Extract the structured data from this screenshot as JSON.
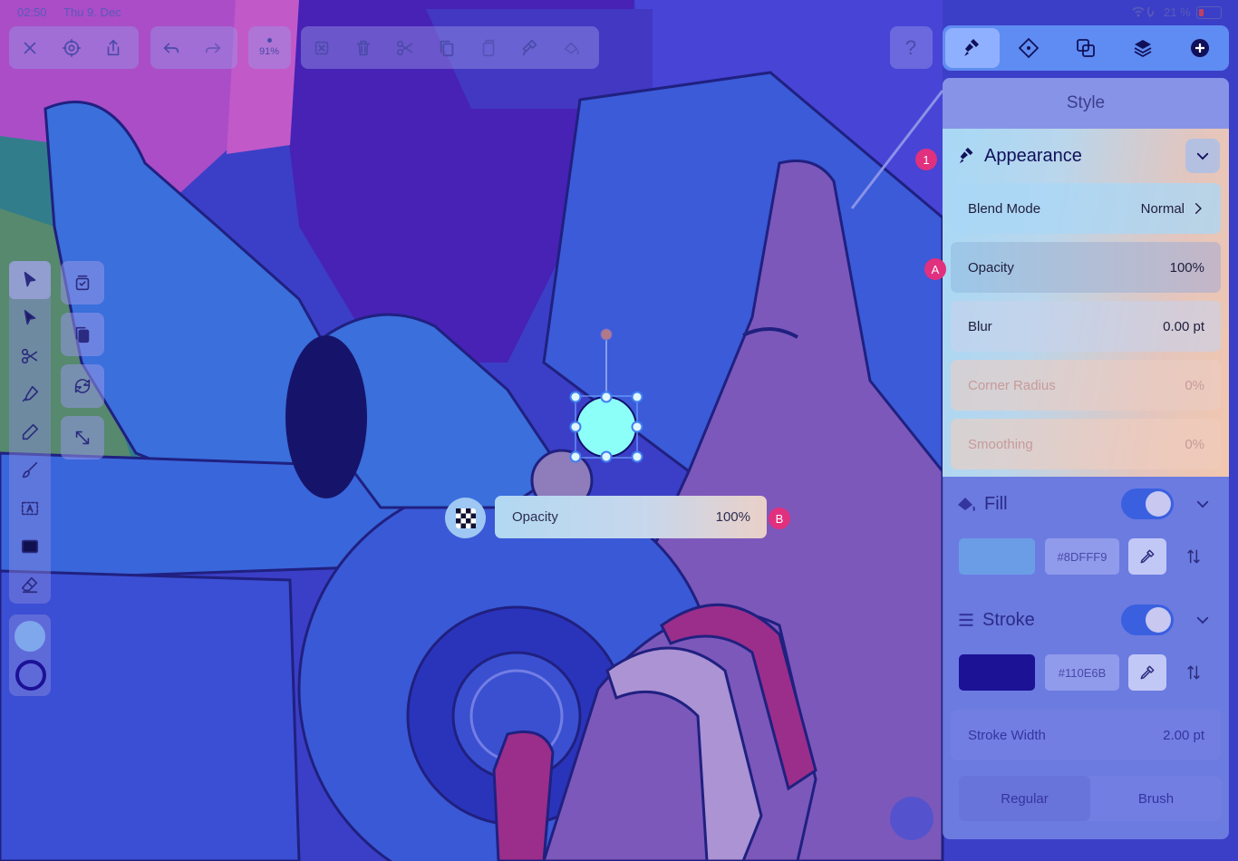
{
  "status_bar": {
    "time": "02:50",
    "date": "Thu 9. Dec",
    "battery": "21 %"
  },
  "toolbar": {
    "zoom": "91%",
    "help": "?"
  },
  "colors": {
    "accent": "#3a60e0",
    "badge": "#e0307e",
    "fill_swatch": "#8DFFF9",
    "stroke_swatch": "#110E6B"
  },
  "panel": {
    "title": "Style",
    "appearance": {
      "label": "Appearance",
      "badge": "1",
      "blend_mode": {
        "label": "Blend Mode",
        "value": "Normal"
      },
      "opacity": {
        "label": "Opacity",
        "value": "100%",
        "badge": "A"
      },
      "blur": {
        "label": "Blur",
        "value": "0.00 pt"
      },
      "corner_radius": {
        "label": "Corner Radius",
        "value": "0%"
      },
      "smoothing": {
        "label": "Smoothing",
        "value": "0%"
      }
    },
    "fill": {
      "label": "Fill",
      "hex": "#8DFFF9",
      "enabled": true
    },
    "stroke": {
      "label": "Stroke",
      "hex": "#110E6B",
      "enabled": true,
      "width_label": "Stroke Width",
      "width_value": "2.00 pt",
      "types": [
        "Regular",
        "Brush"
      ]
    }
  },
  "opacity_popover": {
    "label": "Opacity",
    "value": "100%",
    "badge": "B"
  }
}
